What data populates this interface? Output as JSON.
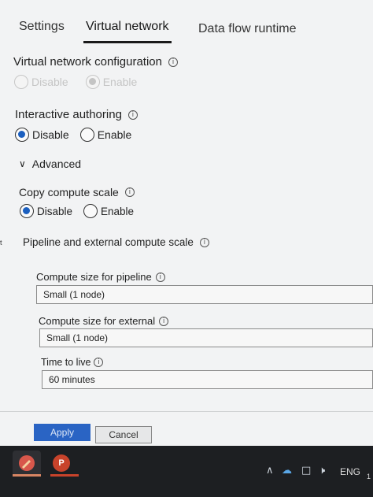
{
  "tabs": [
    {
      "label": "Settings"
    },
    {
      "label": "Virtual network"
    },
    {
      "label": "Data flow runtime"
    }
  ],
  "vnet": {
    "title": "Virtual network configuration",
    "options": [
      "Disable",
      "Enable"
    ],
    "selected": "Enable",
    "disabled": true
  },
  "interactive": {
    "title": "Interactive authoring",
    "options": [
      "Disable",
      "Enable"
    ],
    "selected": "Disable"
  },
  "advanced": {
    "label": "Advanced",
    "icon": "chevron-down-icon"
  },
  "copy_scale": {
    "title": "Copy compute scale",
    "options": [
      "Disable",
      "Enable"
    ],
    "selected": "Disable"
  },
  "pipeline_scale": {
    "title": "Pipeline and external compute scale"
  },
  "pipeline_size": {
    "label": "Compute size for pipeline",
    "value": "Small (1 node)"
  },
  "external_size": {
    "label": "Compute size for external",
    "value": "Small (1 node)"
  },
  "ttl": {
    "label": "Time to live",
    "value": "60 minutes"
  },
  "buttons": {
    "apply": "Apply",
    "cancel": "Cancel"
  },
  "taskbar": {
    "app1_icon": "paint-app-icon",
    "app2_letter": "P",
    "language": "ENG",
    "edge_char": "1"
  },
  "colors": {
    "accent": "#1b5fbf",
    "apply_button": "#2a64c4",
    "taskbar": "#1d1f22"
  }
}
